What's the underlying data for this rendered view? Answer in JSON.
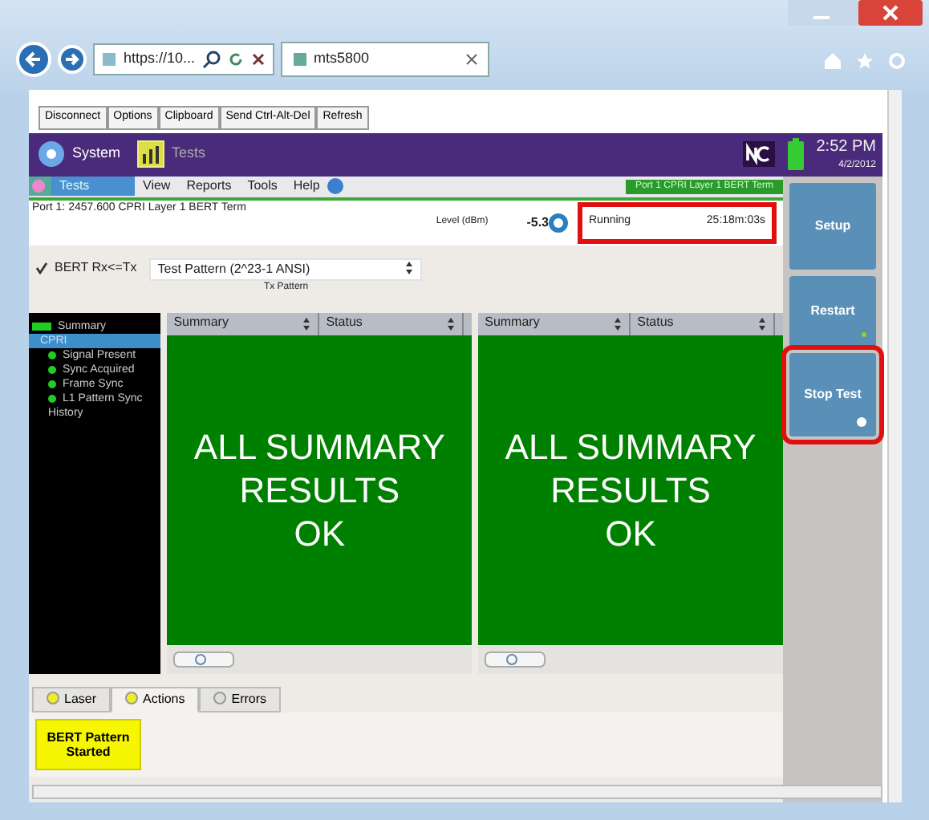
{
  "browser": {
    "address": "https://10...",
    "tab_title": "mts5800"
  },
  "toolbar": [
    "Disconnect",
    "Options",
    "Clipboard",
    "Send Ctrl-Alt-Del",
    "Refresh"
  ],
  "app_bar": {
    "system": "System",
    "tests": "Tests",
    "time": "2:52 PM",
    "date": "4/2/2012"
  },
  "menu": [
    {
      "label": "Tests",
      "selected": true
    },
    {
      "label": "View",
      "selected": false
    },
    {
      "label": "Reports",
      "selected": false
    },
    {
      "label": "Tools",
      "selected": false
    },
    {
      "label": "Help",
      "selected": false
    }
  ],
  "banner": "Port 1 CPRI Layer 1 BERT Term",
  "test_title": "Port 1: 2457.600 CPRI Layer 1 BERT Term",
  "level": {
    "label": "Level (dBm)",
    "value": "-5.3"
  },
  "status": {
    "state": "Running",
    "elapsed": "25:18m:03s",
    "highlighted": true
  },
  "side_buttons": [
    {
      "label": "Setup",
      "kind": "setup",
      "highlighted": false
    },
    {
      "label": "Restart",
      "kind": "restart",
      "highlighted": false
    },
    {
      "label": "Stop Test",
      "kind": "stop",
      "highlighted": true
    }
  ],
  "bert": {
    "checked": true,
    "label": "BERT Rx<=Tx",
    "pattern": "Test Pattern (2^23-1 ANSI)",
    "caption": "Tx Pattern"
  },
  "tree": [
    {
      "label": "Summary",
      "selected": false,
      "color": "#22cc22",
      "children": [
        {
          "label": "CPRI",
          "selected": true,
          "children": [
            {
              "label": "Signal Present",
              "selected": false,
              "color": "#22cc22"
            },
            {
              "label": "Sync Acquired",
              "selected": false,
              "color": "#22cc22"
            },
            {
              "label": "Frame Sync",
              "selected": false,
              "color": "#22cc22"
            },
            {
              "label": "L1 Pattern Sync",
              "selected": false,
              "color": "#22cc22"
            },
            {
              "label": "History",
              "selected": false
            }
          ]
        }
      ]
    }
  ],
  "panels": [
    {
      "columns": [
        "Summary",
        "Status"
      ],
      "message": [
        "ALL SUMMARY",
        "RESULTS",
        "OK"
      ]
    },
    {
      "columns": [
        "Summary",
        "Status"
      ],
      "message": [
        "ALL SUMMARY",
        "RESULTS",
        "OK"
      ]
    }
  ],
  "bottom_tabs": [
    {
      "label": "Laser",
      "selected": false,
      "color": "#eeee22"
    },
    {
      "label": "Actions",
      "selected": true,
      "color": "#eeee22"
    },
    {
      "label": "Errors",
      "selected": false,
      "color": "#dddddd"
    }
  ],
  "action_button": "BERT Pattern Started"
}
